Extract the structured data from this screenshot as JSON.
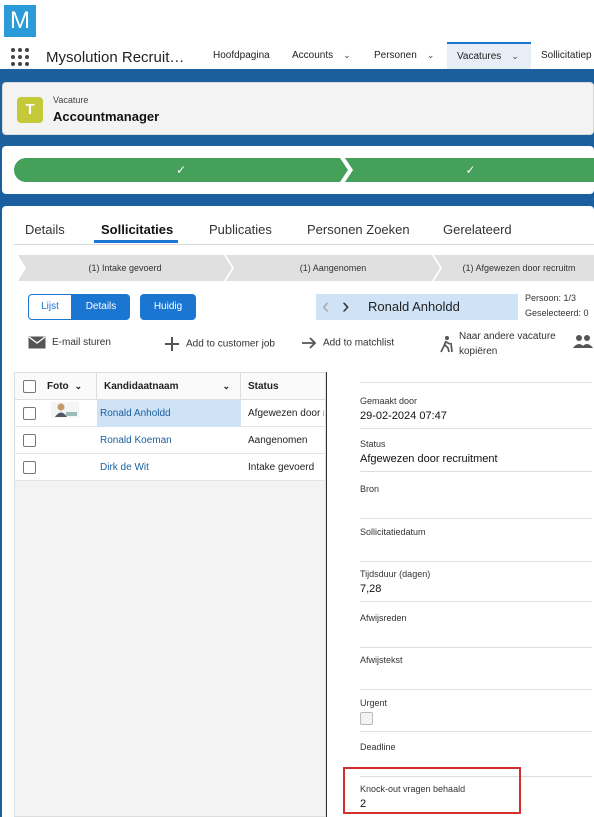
{
  "app": {
    "logo_letter": "M",
    "name": "Mysolution Recruit…"
  },
  "nav": {
    "items": [
      {
        "label": "Hoofdpagina"
      },
      {
        "label": "Accounts"
      },
      {
        "label": "Personen"
      },
      {
        "label": "Vacatures"
      },
      {
        "label": "Sollicitatiep"
      }
    ]
  },
  "record": {
    "type_label": "Vacature",
    "title": "Accountmanager"
  },
  "path": {
    "steps": [
      "✓",
      "✓"
    ]
  },
  "tabs": [
    "Details",
    "Sollicitaties",
    "Publicaties",
    "Personen Zoeken",
    "Gerelateerd"
  ],
  "stages": [
    "(1) Intake gevoerd",
    "(1) Aangenomen",
    "(1) Afgewezen door recruitm"
  ],
  "toolbar": {
    "lijst": "Lijst",
    "details": "Details",
    "huidig": "Huidig",
    "current_person": "Ronald Anholdd",
    "persoon": "Persoon: 1/3",
    "geselecteerd": "Geselecteerd: 0"
  },
  "actions": {
    "email": "E-mail sturen",
    "customer_job": "Add to customer job",
    "matchlist": "Add to matchlist",
    "copy_line1": "Naar andere vacature",
    "copy_line2": "kopiëren"
  },
  "table": {
    "headers": [
      "Foto",
      "Kandidaatnaam",
      "Status"
    ],
    "rows": [
      {
        "name": "Ronald Anholdd",
        "status": "Afgewezen door recruitment"
      },
      {
        "name": "Ronald Koeman",
        "status": "Aangenomen"
      },
      {
        "name": "Dirk de Wit",
        "status": "Intake gevoerd"
      }
    ]
  },
  "details": {
    "gemaakt_door": {
      "label": "Gemaakt door",
      "value": "29-02-2024 07:47"
    },
    "status": {
      "label": "Status",
      "value": "Afgewezen door recruitment"
    },
    "bron": {
      "label": "Bron",
      "value": ""
    },
    "sollicitatiedatum": {
      "label": "Sollicitatiedatum",
      "value": ""
    },
    "tijdsduur": {
      "label": "Tijdsduur (dagen)",
      "value": "7,28"
    },
    "afwijsreden": {
      "label": "Afwijsreden",
      "value": ""
    },
    "afwijstekst": {
      "label": "Afwijstekst",
      "value": ""
    },
    "urgent": {
      "label": "Urgent",
      "checked": false
    },
    "deadline": {
      "label": "Deadline",
      "value": ""
    },
    "knockout": {
      "label": "Knock-out vragen behaald",
      "value": "2"
    }
  },
  "colors": {
    "brand_blue": "#1b76d2",
    "path_green": "#45a05a",
    "highlight_red": "#d32f2f"
  }
}
